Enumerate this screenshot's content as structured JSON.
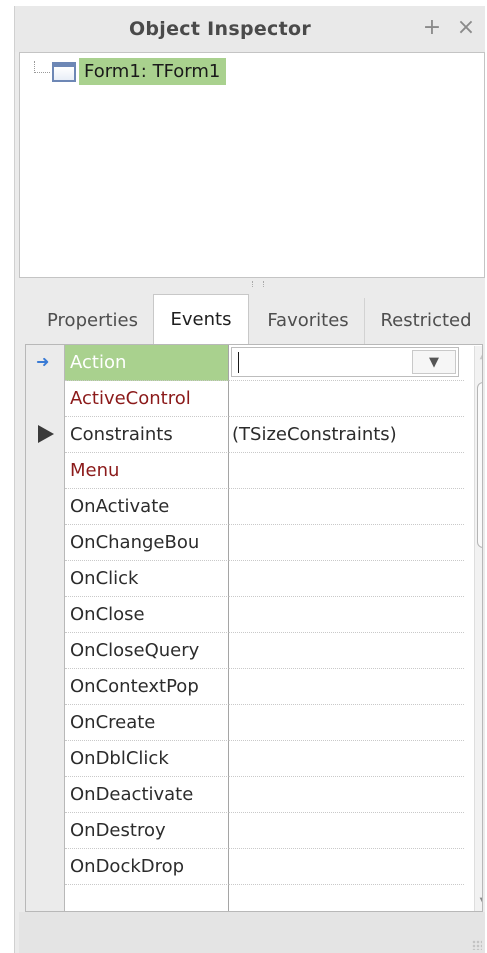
{
  "window": {
    "title": "Object Inspector",
    "pin_glyph": "+",
    "close_glyph": "×"
  },
  "tree": {
    "items": [
      {
        "label": "Form1: TForm1",
        "icon": "form-icon",
        "selected": true
      }
    ]
  },
  "tabs": [
    {
      "label": "Properties",
      "active": false
    },
    {
      "label": "Events",
      "active": true
    },
    {
      "label": "Favorites",
      "active": false
    },
    {
      "label": "Restricted",
      "active": false
    }
  ],
  "grid": {
    "selected_marker": "➜",
    "combo": {
      "value": "",
      "dropdown_glyph": "▼"
    },
    "rows": [
      {
        "name": "Action",
        "value": "",
        "selected": true
      },
      {
        "name": "ActiveControl",
        "value": "",
        "highlight": "#8b1a1a"
      },
      {
        "name": "Constraints",
        "value": "(TSizeConstraints)",
        "expandable": true
      },
      {
        "name": "Menu",
        "value": "",
        "highlight": "#8b1a1a"
      },
      {
        "name": "OnActivate",
        "value": ""
      },
      {
        "name": "OnChangeBou",
        "value": ""
      },
      {
        "name": "OnClick",
        "value": ""
      },
      {
        "name": "OnClose",
        "value": ""
      },
      {
        "name": "OnCloseQuery",
        "value": ""
      },
      {
        "name": "OnContextPop",
        "value": ""
      },
      {
        "name": "OnCreate",
        "value": ""
      },
      {
        "name": "OnDblClick",
        "value": ""
      },
      {
        "name": "OnDeactivate",
        "value": ""
      },
      {
        "name": "OnDestroy",
        "value": ""
      },
      {
        "name": "OnDockDrop",
        "value": ""
      },
      {
        "name": "",
        "value": ""
      }
    ],
    "scrollbar": {
      "up_glyph": "▲",
      "down_glyph": "▼"
    }
  },
  "colors": {
    "selection": "#a9d18e",
    "component_property": "#8b1a1a",
    "accent_arrow": "#3a7bd5"
  }
}
